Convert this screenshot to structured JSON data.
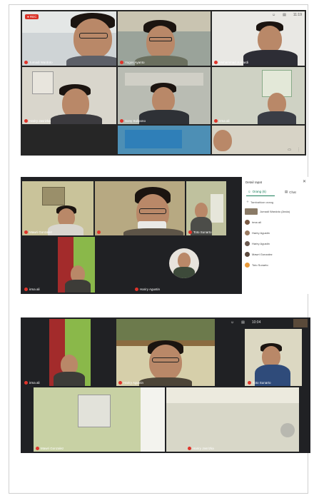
{
  "shot1": {
    "rec_badge": "● REC",
    "clock": "11:19",
    "tiles": [
      {
        "name": "Jumadi Wardoto"
      },
      {
        "name": "Yugos Ayanto"
      },
      {
        "name": "Muhammad Jumardi"
      },
      {
        "name": "Hariry Jasrizka"
      },
      {
        "name": "Sony Sulipono"
      },
      {
        "name": "irma ali"
      },
      {
        "name": ""
      },
      {
        "name": ""
      }
    ]
  },
  "shot2": {
    "tiles": [
      {
        "name": "Mawri Gonzalez"
      },
      {
        "name": ""
      },
      {
        "name": "Toto Sunarto"
      },
      {
        "name": "irma ali"
      },
      {
        "name": ""
      },
      {
        "name": "Hariry Agustin"
      }
    ],
    "panel": {
      "title": "Detail rapat",
      "tab_people": "Orang (6)",
      "tab_chat": "Chat",
      "add_people": "Tambahkan orang",
      "participants": [
        "Jumadi Wardoto (Anda)",
        "irma ali",
        "Hariry Agustin",
        "Hariry Agustin",
        "Mawri Gonzalez",
        "Toto Sunarto"
      ]
    }
  },
  "shot3": {
    "clock": "10:04",
    "tiles": [
      {
        "name": "irma ali"
      },
      {
        "name": "Hariry Agustin"
      },
      {
        "name": "Toto Sunarto"
      },
      {
        "name": "Mawri Gonzalez"
      },
      {
        "name": "Hariry Jasrizka"
      }
    ]
  }
}
